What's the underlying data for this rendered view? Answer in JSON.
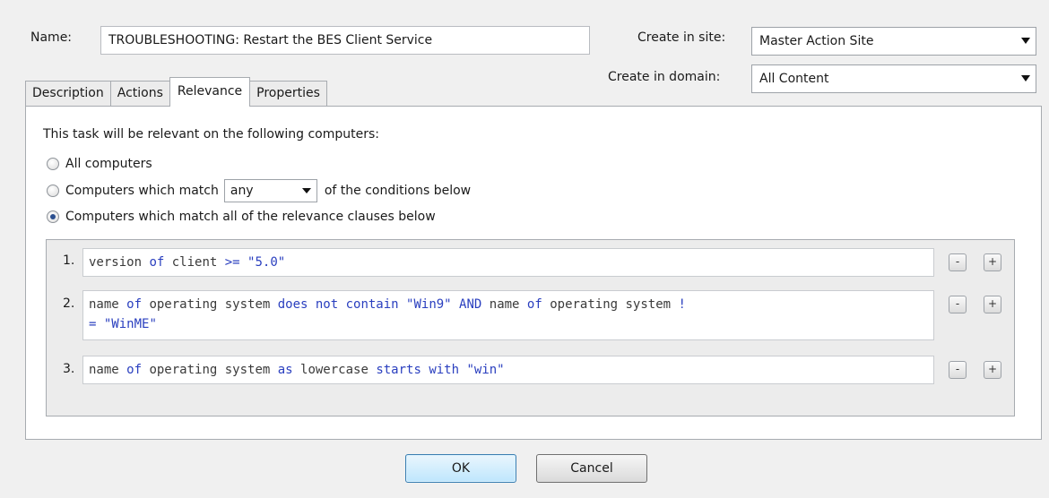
{
  "form": {
    "name_label": "Name:",
    "name_value": "TROUBLESHOOTING: Restart the BES Client Service",
    "site_label": "Create in site:",
    "site_value": "Master Action Site",
    "domain_label": "Create in domain:",
    "domain_value": "All Content"
  },
  "tabs": [
    {
      "label": "Description"
    },
    {
      "label": "Actions"
    },
    {
      "label": "Relevance",
      "active": true
    },
    {
      "label": "Properties"
    }
  ],
  "relevance": {
    "intro": "This task will be relevant on the following computers:",
    "option_all": "All computers",
    "option_match_prefix": "Computers which match",
    "match_select_value": "any",
    "option_match_suffix": "of the conditions below",
    "option_clauses": "Computers which match all of the relevance clauses below",
    "selected_option": "clauses"
  },
  "clauses": [
    {
      "num": "1.",
      "text": "version of client >= \"5.0\""
    },
    {
      "num": "2.",
      "text": "name of operating system does not contain \"Win9\" AND name of operating system != \"WinME\""
    },
    {
      "num": "3.",
      "text": "name of operating system as lowercase starts with \"win\""
    }
  ],
  "buttons": {
    "remove": "-",
    "add": "+",
    "ok": "OK",
    "cancel": "Cancel"
  },
  "colors": {
    "keyword": "#2a3fbf",
    "default_button_border": "#3c7fb1",
    "radio_dot": "#2b4f8f"
  }
}
